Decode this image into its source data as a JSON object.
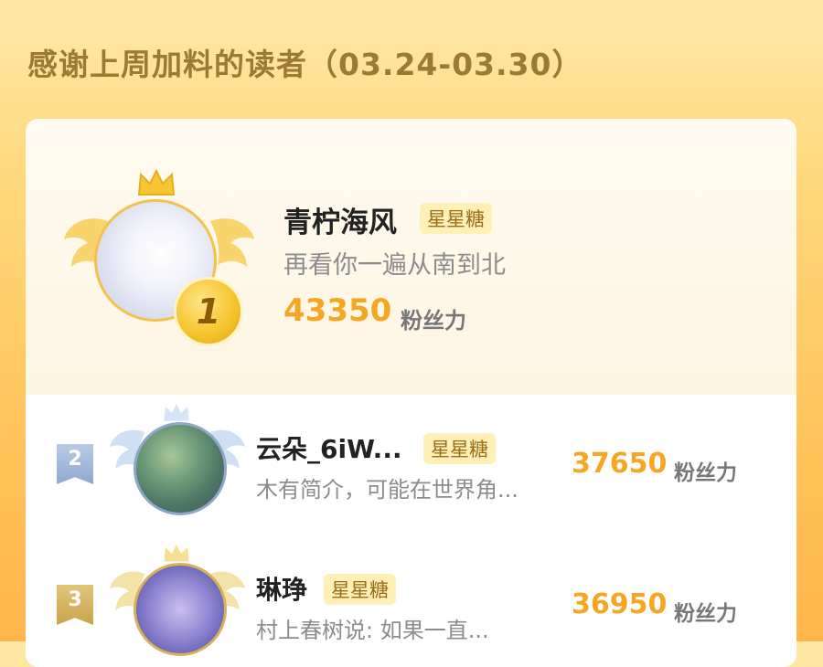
{
  "header": {
    "title": "感谢上周加料的读者（03.24-03.30）"
  },
  "readers": [
    {
      "rank": "1",
      "name": "青柠海风",
      "badge": "星星糖",
      "bio": "再看你一遍从南到北",
      "score": "43350",
      "unit": "粉丝力"
    },
    {
      "rank": "2",
      "name": "云朵_6iW...",
      "badge": "星星糖",
      "bio": "木有简介，可能在世界角...",
      "score": "37650",
      "unit": "粉丝力"
    },
    {
      "rank": "3",
      "name": "琳琤",
      "badge": "星星糖",
      "bio": "村上春树说: 如果一直...",
      "score": "36950",
      "unit": "粉丝力"
    }
  ],
  "colors": {
    "accent": "#f5a623",
    "gold": "#f2c24c",
    "silver": "#8ea7c8",
    "bronze": "#d6b25a",
    "badge_bg": "#fff0b8"
  }
}
